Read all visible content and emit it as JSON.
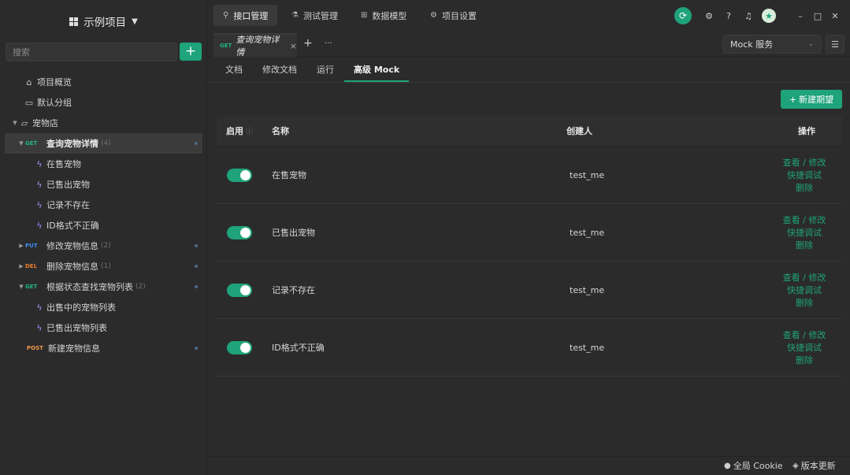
{
  "sidebar": {
    "project_name": "示例项目",
    "search_placeholder": "搜索",
    "add_label": "+",
    "tree": {
      "overview": "项目概览",
      "default_group": "默认分组",
      "pet_store": "宠物店",
      "get_pet_detail": {
        "method": "GET",
        "name": "查询宠物详情",
        "count": "(4)"
      },
      "cases1": [
        "在售宠物",
        "已售出宠物",
        "记录不存在",
        "ID格式不正确"
      ],
      "put_pet": {
        "method": "PUT",
        "name": "修改宠物信息",
        "count": "(2)"
      },
      "del_pet": {
        "method": "DEL",
        "name": "删除宠物信息",
        "count": "(1)"
      },
      "get_by_status": {
        "method": "GET",
        "name": "根据状态查找宠物列表",
        "count": "(2)"
      },
      "cases2": [
        "出售中的宠物列表",
        "已售出宠物列表"
      ],
      "post_pet": {
        "method": "POST",
        "name": "新建宠物信息"
      }
    }
  },
  "topnav": {
    "tabs": [
      "接口管理",
      "测试管理",
      "数据模型",
      "项目设置"
    ]
  },
  "docstrip": {
    "tab_method": "GET",
    "tab_title": "查询宠物详情",
    "close": "×",
    "add": "+",
    "more": "···",
    "mock_service": "Mock 服务"
  },
  "subtabs": [
    "文档",
    "修改文档",
    "运行",
    "高级 Mock"
  ],
  "content": {
    "new_button": "新建期望",
    "headers": {
      "enable": "启用",
      "name": "名称",
      "creator": "创建人",
      "ops": "操作"
    },
    "rows": [
      {
        "name": "在售宠物",
        "creator": "test_me",
        "enabled": true
      },
      {
        "name": "已售出宠物",
        "creator": "test_me",
        "enabled": true
      },
      {
        "name": "记录不存在",
        "creator": "test_me",
        "enabled": true
      },
      {
        "name": "ID格式不正确",
        "creator": "test_me",
        "enabled": true
      }
    ],
    "ops": {
      "view_edit": "查看 / 修改",
      "quick_debug": "快捷调试",
      "delete": "删除"
    }
  },
  "statusbar": {
    "cookie": "全局 Cookie",
    "update": "版本更新"
  },
  "colors": {
    "accent": "#1fa37a",
    "bg": "#2b2b2b"
  }
}
